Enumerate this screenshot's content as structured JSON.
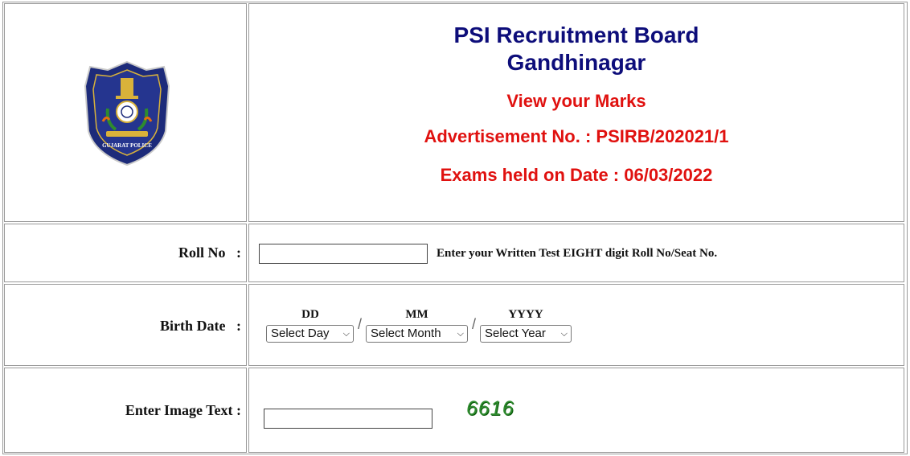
{
  "header": {
    "logo_text": "GUJARAT POLICE",
    "title_line1": "PSI Recruitment Board",
    "title_line2": "Gandhinagar",
    "subtitle": "View your Marks",
    "advertisement": "Advertisement No. : PSIRB/202021/1",
    "exam_date": "Exams held on Date : 06/03/2022"
  },
  "form": {
    "roll_no": {
      "label": "Roll No   :",
      "value": "",
      "hint": "Enter your Written Test EIGHT digit Roll No/Seat No."
    },
    "birth_date": {
      "label": "Birth Date   :",
      "day_label": "DD",
      "month_label": "MM",
      "year_label": "YYYY",
      "day_selected": "Select Day",
      "month_selected": "Select Month",
      "year_selected": "Select Year",
      "separator": "/"
    },
    "captcha": {
      "label": "Enter Image Text :",
      "value": "",
      "image_text": "6616"
    }
  },
  "colors": {
    "title_blue": "#0d0d7a",
    "accent_red": "#e0110f",
    "captcha_green": "#2e8b2e",
    "border_gray": "#9a9a9a"
  }
}
